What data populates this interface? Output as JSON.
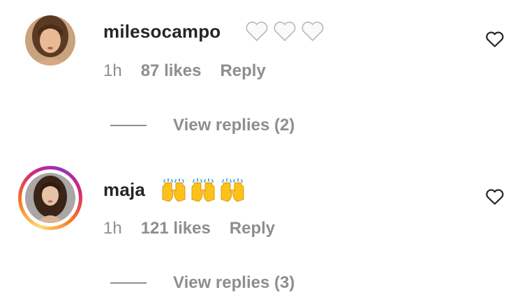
{
  "comments": [
    {
      "username": "milesocampo",
      "emoji": [
        "white-heart",
        "white-heart",
        "white-heart"
      ],
      "time": "1h",
      "likes": "87 likes",
      "reply_label": "Reply",
      "view_replies": "View replies (2)",
      "story_ring": false
    },
    {
      "username": "maja",
      "emoji": [
        "raising-hands",
        "raising-hands",
        "raising-hands"
      ],
      "time": "1h",
      "likes": "121 likes",
      "reply_label": "Reply",
      "view_replies": "View replies (3)",
      "story_ring": true
    }
  ],
  "colors": {
    "text_primary": "#262626",
    "text_secondary": "#8e8e8e",
    "story_ring": [
      "#feda75",
      "#fa7e1e",
      "#d62976",
      "#962fbf"
    ]
  }
}
